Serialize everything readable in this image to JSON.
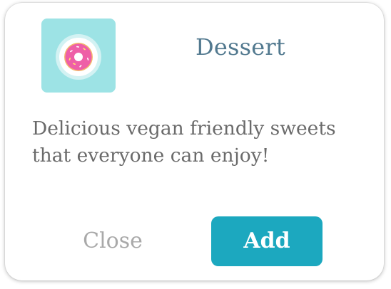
{
  "dialog": {
    "icon": "donut-icon",
    "title": "Dessert",
    "description": "Delicious vegan friendly sweets that everyone can enjoy!",
    "close_label": "Close",
    "add_label": "Add"
  },
  "colors": {
    "accent": "#1ca8bf",
    "icon_tile": "#9de3e5",
    "title": "#52798f",
    "body_text": "#6a6a6a",
    "secondary_text": "#a9a9a9",
    "donut_frosting": "#ee5fa7",
    "donut_dough": "#f3b96b"
  }
}
